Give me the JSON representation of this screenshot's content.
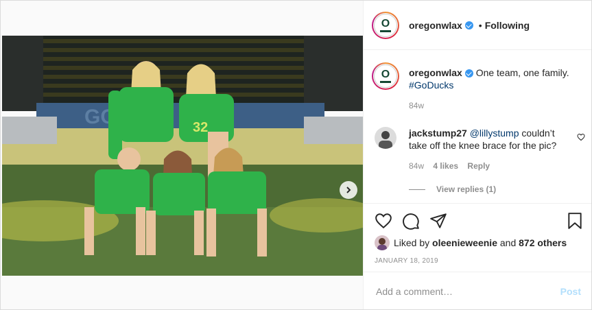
{
  "account": {
    "username": "oregonwlax",
    "follow_sep": "•",
    "follow_status": "Following",
    "logo_letter": "O"
  },
  "caption": {
    "username": "oregonwlax",
    "text": "One team, one family.",
    "hashtag": "#GoDucks",
    "time": "84w"
  },
  "comment": {
    "username": "jackstump27",
    "mention": "@lillystump",
    "text": "couldn’t take off the knee brace for the pic?",
    "time": "84w",
    "likes": "4 likes",
    "reply": "Reply",
    "view_replies": "View replies (1)"
  },
  "likes": {
    "prefix": "Liked by",
    "user": "oleenieweenie",
    "and": "and",
    "others": "872 others"
  },
  "date": "JANUARY 18, 2019",
  "add_comment": {
    "placeholder": "Add a comment…",
    "post_label": "Post"
  },
  "carousel": {
    "slide_count": 4,
    "active_index": 0
  },
  "colors": {
    "accent": "#0095f6",
    "verified": "#3897f0",
    "post_disabled": "#b2dffc",
    "jersey": "#2fb24a",
    "turf": "#4d6b34"
  },
  "icons": {
    "like": "heart-icon",
    "comment": "comment-icon",
    "share": "paper-plane-icon",
    "save": "bookmark-icon",
    "next": "chevron-right-icon",
    "comment_like": "small-heart-icon"
  }
}
